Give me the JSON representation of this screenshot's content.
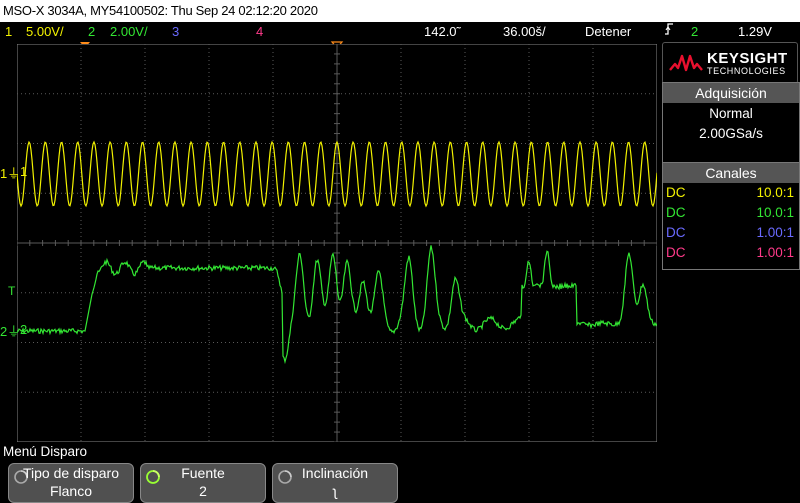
{
  "title_bar": {
    "text": "MSO-X 3034A, MY54100502: Thu Sep 24 02:12:20 2020"
  },
  "status": {
    "ch1_num": "1",
    "ch1_scale": "5.00V/",
    "ch2_num": "2",
    "ch2_scale": "2.00V/",
    "ch3_num": "3",
    "ch4_num": "4",
    "delay": "142.0̃",
    "timebase": "36.00š/",
    "run_state": "Detener",
    "trig_source": "2",
    "trig_level": "1.29V"
  },
  "markers": {
    "ch1": "1",
    "ch2": "2",
    "trigger": "T"
  },
  "brand": {
    "name": "KEYSIGHT",
    "sub": "TECHNOLOGIES"
  },
  "acquisition": {
    "header": "Adquisición",
    "mode": "Normal",
    "rate": "2.00GSa/s"
  },
  "channels": {
    "header": "Canales",
    "rows": [
      {
        "coupling": "DC",
        "probe": "10.0:1",
        "color": "#f2f200"
      },
      {
        "coupling": "DC",
        "probe": "10.0:1",
        "color": "#33e633"
      },
      {
        "coupling": "DC",
        "probe": "1.00:1",
        "color": "#6a6aff"
      },
      {
        "coupling": "DC",
        "probe": "1.00:1",
        "color": "#ff3a8a"
      }
    ]
  },
  "menu": {
    "title": "Menú Disparo",
    "softkeys": [
      {
        "label": "Tipo de disparo",
        "value": "Flanco"
      },
      {
        "label": "Fuente",
        "value": "2"
      },
      {
        "label": "Inclinación",
        "value": "ʅ"
      }
    ]
  },
  "colors": {
    "ch1": "#f2f200",
    "ch2": "#33e633",
    "ch3": "#6a6aff",
    "ch4": "#ff3a8a",
    "trigger": "#ff8c1a",
    "grid": "#5a5a5a"
  }
}
